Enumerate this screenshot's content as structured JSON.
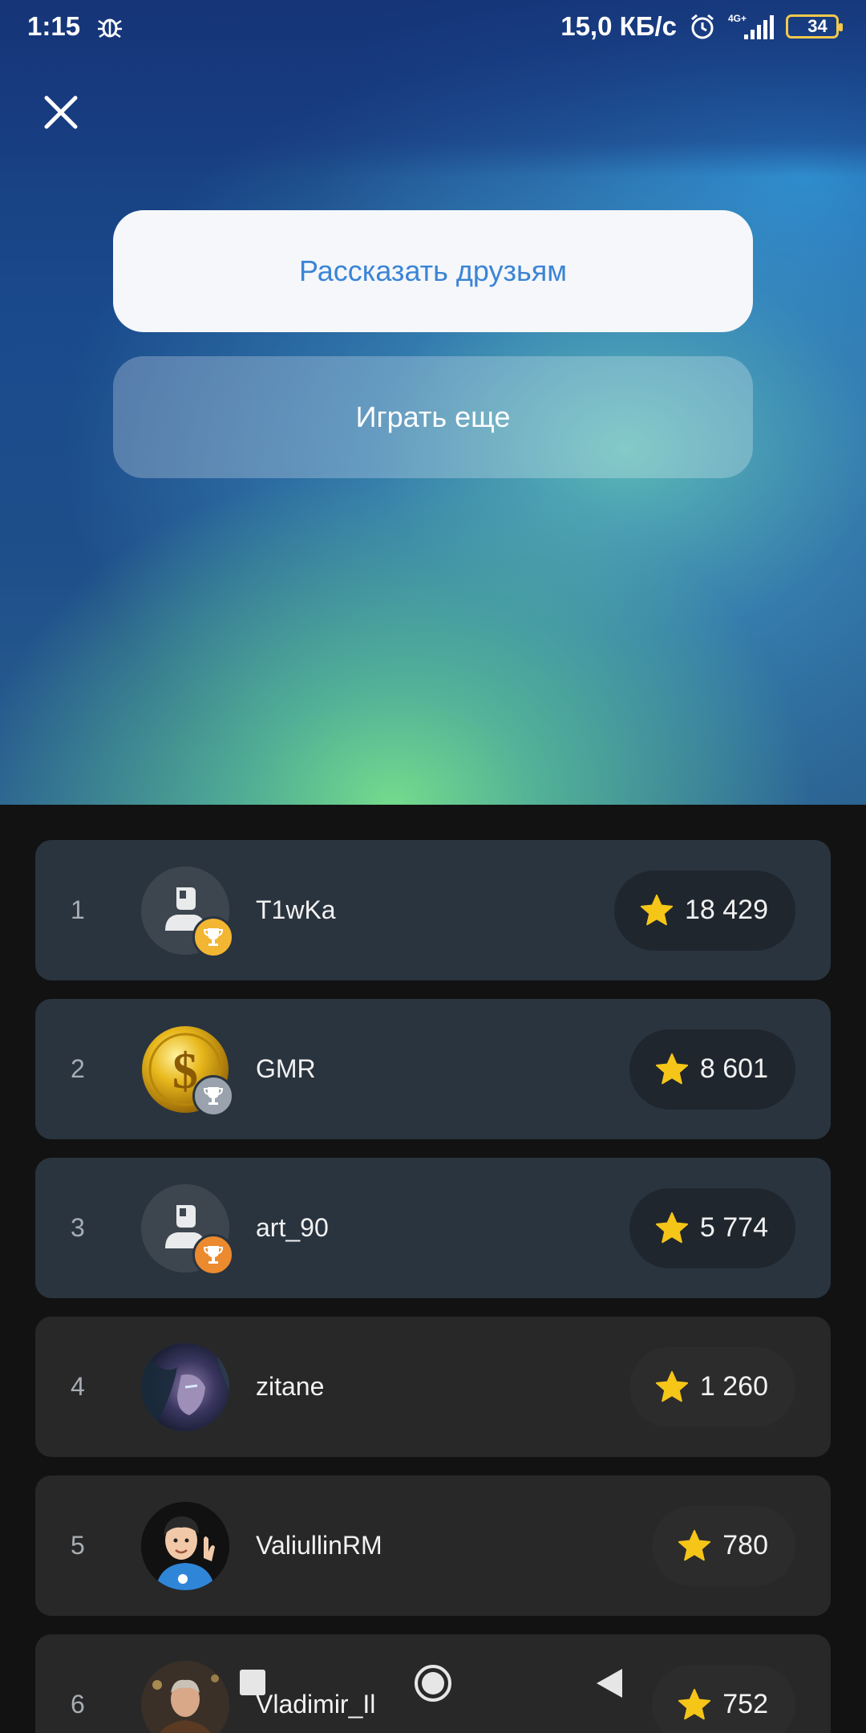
{
  "status_bar": {
    "time": "1:15",
    "network_speed": "15,0 КБ/с",
    "network_type": "4G+",
    "battery_level": "34",
    "icons": [
      "bug-icon",
      "alarm-icon",
      "signal-icon",
      "battery-icon"
    ]
  },
  "header": {
    "close_icon": "close-icon"
  },
  "actions": {
    "share_label": "Рассказать друзьям",
    "play_again_label": "Играть еще"
  },
  "leaderboard": {
    "rows": [
      {
        "rank": "1",
        "name": "T1wKa",
        "score": "18 429",
        "avatar": "default-avatar",
        "trophy": "gold"
      },
      {
        "rank": "2",
        "name": "GMR",
        "score": "8 601",
        "avatar": "gold-coin-avatar",
        "trophy": "silver"
      },
      {
        "rank": "3",
        "name": "art_90",
        "score": "5 774",
        "avatar": "default-avatar",
        "trophy": "bronze"
      },
      {
        "rank": "4",
        "name": "zitane",
        "score": "1 260",
        "avatar": "fantasy-character-avatar",
        "trophy": ""
      },
      {
        "rank": "5",
        "name": "ValiullinRM",
        "score": "780",
        "avatar": "cartoon-man-avatar",
        "trophy": ""
      },
      {
        "rank": "6",
        "name": "Vladimir_Il",
        "score": "752",
        "avatar": "photo-avatar",
        "trophy": ""
      }
    ]
  },
  "colors": {
    "share_text": "#3b84d6",
    "top_row_bg": "#2a343f",
    "regular_row_bg": "#282828",
    "star": "#f5c518",
    "trophy_gold": "#f2b632",
    "trophy_silver": "#9aa3ad",
    "trophy_bronze": "#eb8a2f"
  },
  "system_nav": {
    "icons": [
      "recent-apps-icon",
      "home-icon",
      "back-icon"
    ]
  }
}
